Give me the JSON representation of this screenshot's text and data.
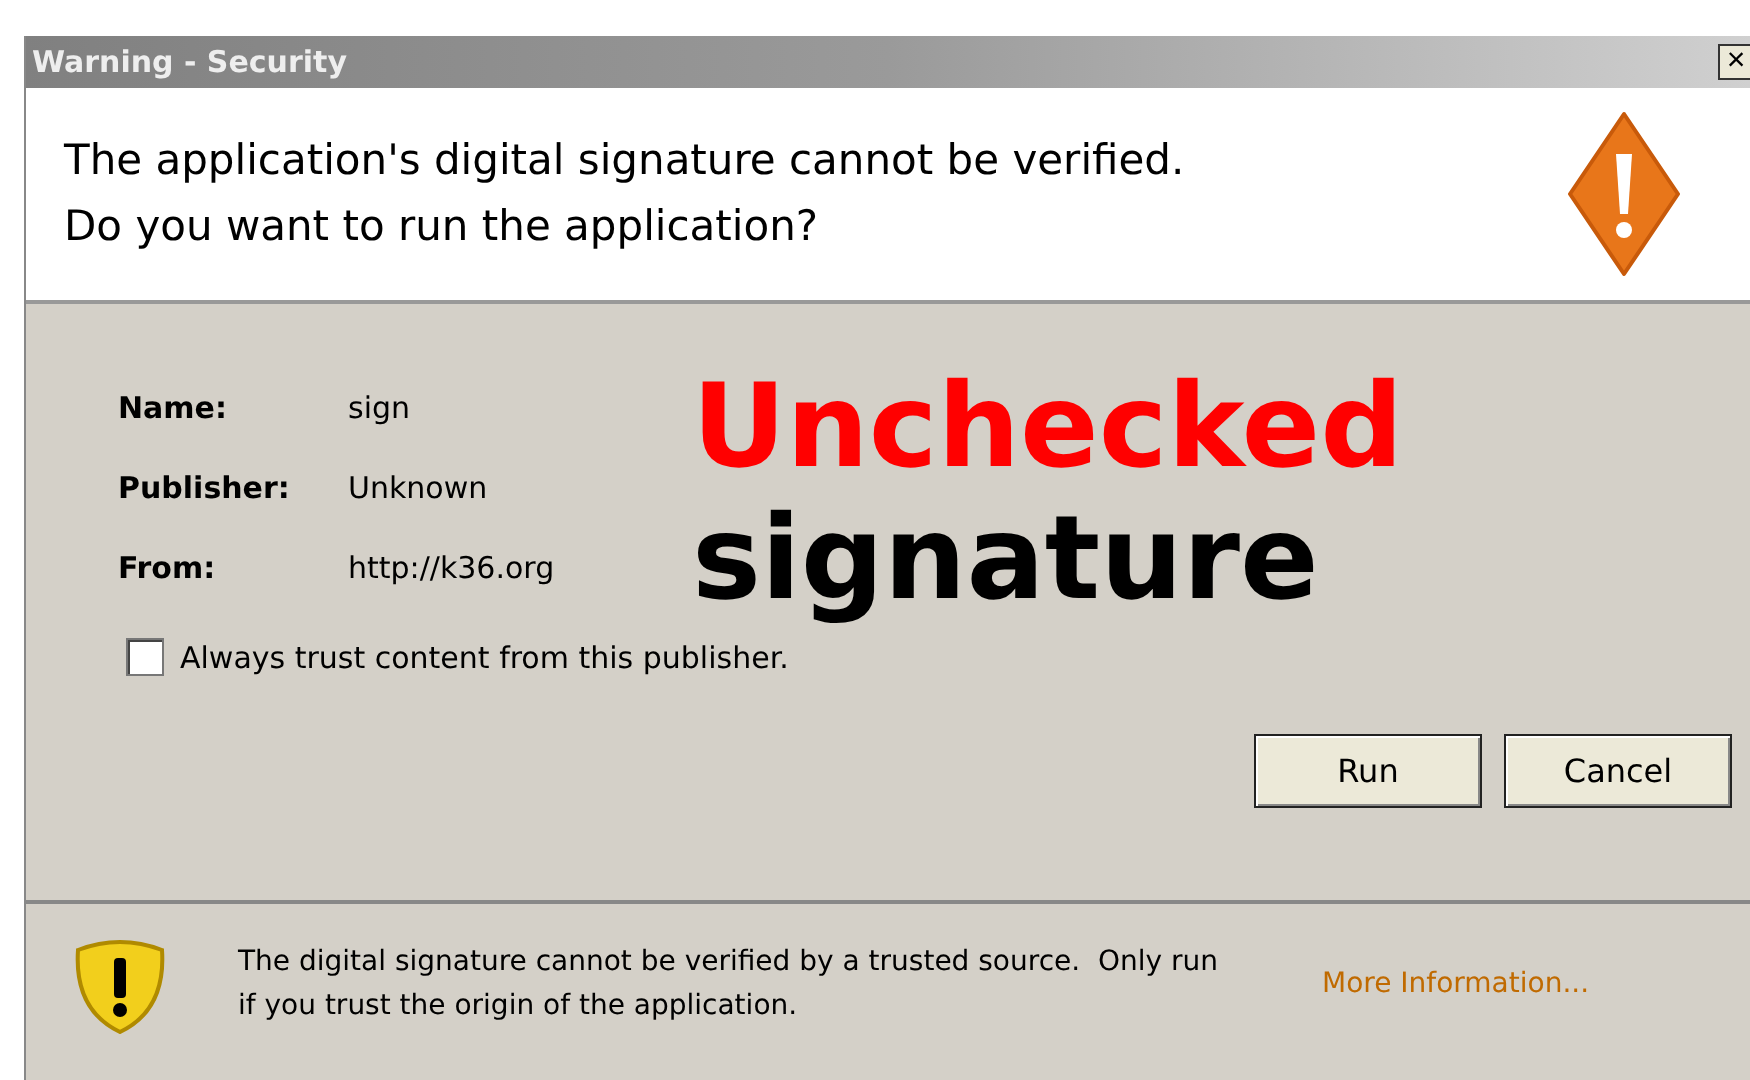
{
  "window": {
    "title": "Warning - Security",
    "close": "×"
  },
  "header": {
    "lines": [
      "The application's digital signature cannot be verified.",
      "Do you want to run the application?"
    ]
  },
  "fields": [
    {
      "label": "Name:",
      "value": "sign"
    },
    {
      "label": "Publisher:",
      "value": "Unknown"
    },
    {
      "label": "From:",
      "value": "http://k36.org"
    }
  ],
  "trust_checkbox": {
    "label": "Always trust content from this publisher.",
    "checked": false
  },
  "buttons": [
    "Run",
    "Cancel"
  ],
  "annotation": [
    {
      "text": "Unchecked",
      "color": "#ff0000"
    },
    {
      "text": "signature",
      "color": "#000000"
    }
  ],
  "footer": {
    "message": "The digital signature cannot be verified by a trusted source.  Only run if you trust the origin of the application.",
    "link": "More Information..."
  }
}
